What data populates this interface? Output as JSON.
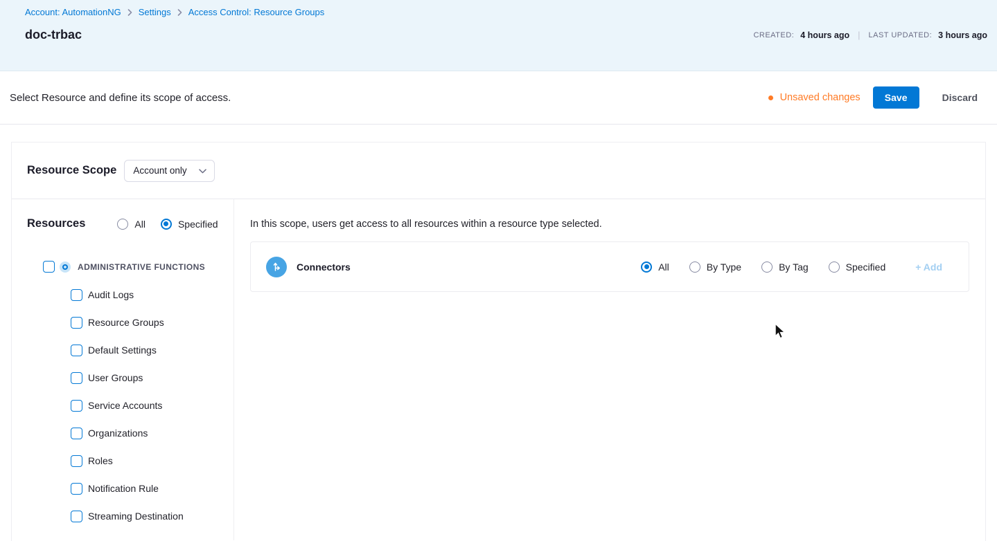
{
  "colors": {
    "primary_blue": "#0278D5",
    "header_bg": "#EBF5FB",
    "unsaved_orange": "#FF7B26",
    "connector_icon_blue": "#47A4E4",
    "add_disabled_blue": "#A3CFF2",
    "text_dark": "#1B1B28",
    "text_gray": "#6B6D85"
  },
  "breadcrumb": {
    "items": [
      "Account: AutomationNG",
      "Settings",
      "Access Control: Resource Groups"
    ]
  },
  "header": {
    "title": "doc-trbac",
    "created_label": "CREATED:",
    "created_value": "4 hours ago",
    "separator": "|",
    "updated_label": "LAST UPDATED:",
    "updated_value": "3 hours ago"
  },
  "toolbar": {
    "description": "Select Resource and define its scope of access.",
    "unsaved_label": "Unsaved changes",
    "save_label": "Save",
    "discard_label": "Discard"
  },
  "scope": {
    "label": "Resource Scope",
    "selected_value": "Account only"
  },
  "resources": {
    "heading": "Resources",
    "filter_options": {
      "all": "All",
      "specified": "Specified"
    },
    "selected_filter": "Specified",
    "group": {
      "label": "ADMINISTRATIVE FUNCTIONS",
      "checked": false
    },
    "items": [
      "Audit Logs",
      "Resource Groups",
      "Default Settings",
      "User Groups",
      "Service Accounts",
      "Organizations",
      "Roles",
      "Notification Rule",
      "Streaming Destination"
    ]
  },
  "main": {
    "info_text": "In this scope, users get access to all resources within a resource type selected.",
    "connectors": {
      "label": "Connectors",
      "options": [
        "All",
        "By Type",
        "By Tag",
        "Specified"
      ],
      "selected_option": "All",
      "add_label": "+ Add"
    }
  }
}
